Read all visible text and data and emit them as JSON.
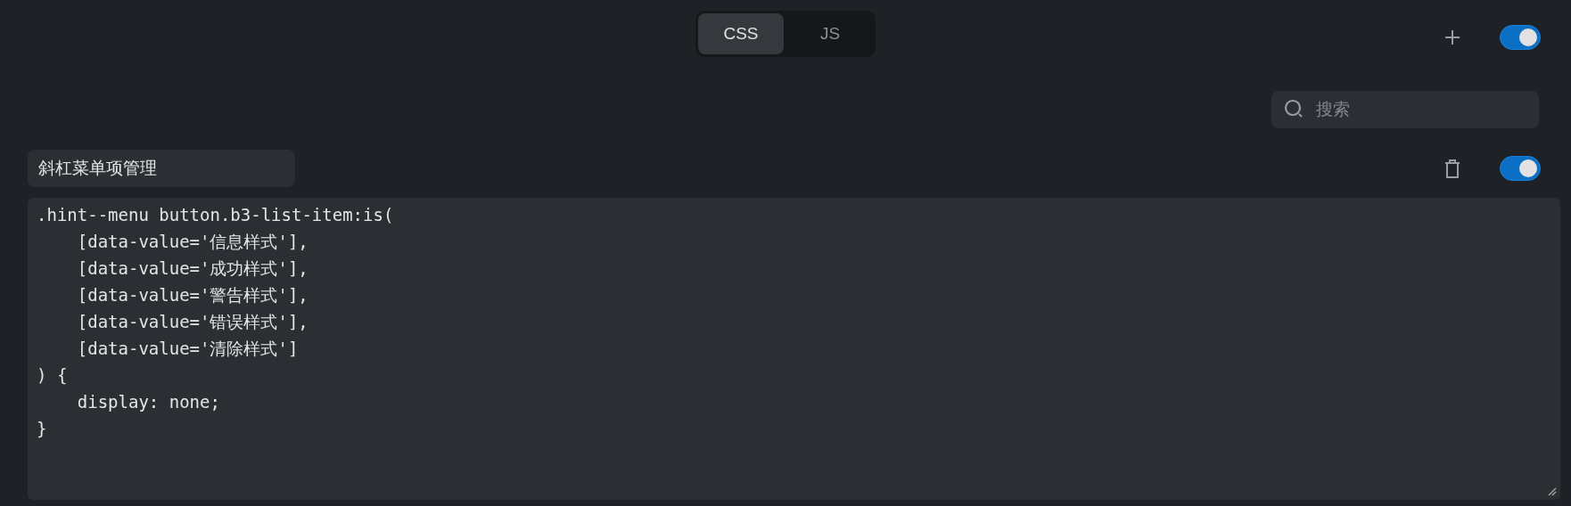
{
  "tabs": [
    {
      "label": "CSS",
      "selected": true
    },
    {
      "label": "JS",
      "selected": false
    }
  ],
  "global_toggle": {
    "on": true
  },
  "search": {
    "placeholder": "搜索"
  },
  "snippets": [
    {
      "title": "斜杠菜单项管理",
      "on": true,
      "code": ".hint--menu button.b3-list-item:is(\n    [data-value='信息样式'],\n    [data-value='成功样式'],\n    [data-value='警告样式'],\n    [data-value='错误样式'],\n    [data-value='清除样式']\n) {\n    display: none;\n}"
    }
  ]
}
